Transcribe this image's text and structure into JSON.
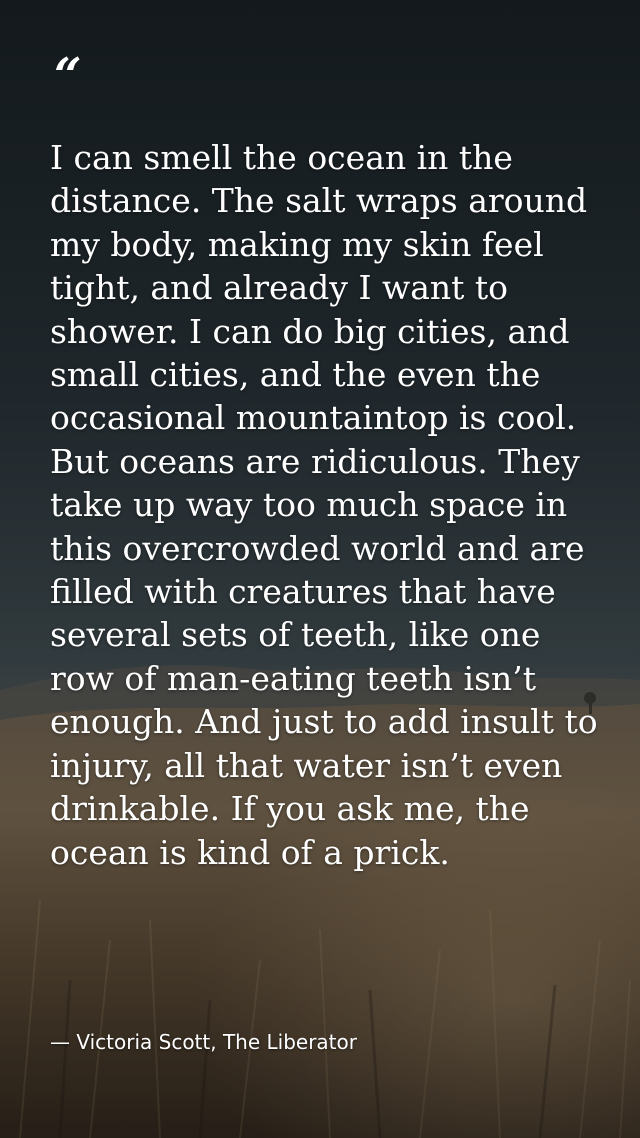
{
  "quote": {
    "mark": "“",
    "text": "I can smell the ocean in the distance. The salt wraps around my body, making my skin feel tight, and already I want to shower. I can do big cities, and small cities, and the even the occasional mountaintop is cool. But oceans are ridiculous. They take up way too much space in this overcrowded world and are filled with creatures that have several sets of teeth, like one row of man-eating teeth isn’t enough. And just to add insult to injury, all that water isn’t even drinkable. If you ask me, the ocean is kind of a prick.",
    "attribution": "— Victoria Scott, The Liberator"
  },
  "colors": {
    "sky_top": "#1a2126",
    "sky_mid": "#2c363b",
    "field_dark": "#3a3024",
    "field_light": "#8a7559",
    "text": "#ffffff"
  }
}
